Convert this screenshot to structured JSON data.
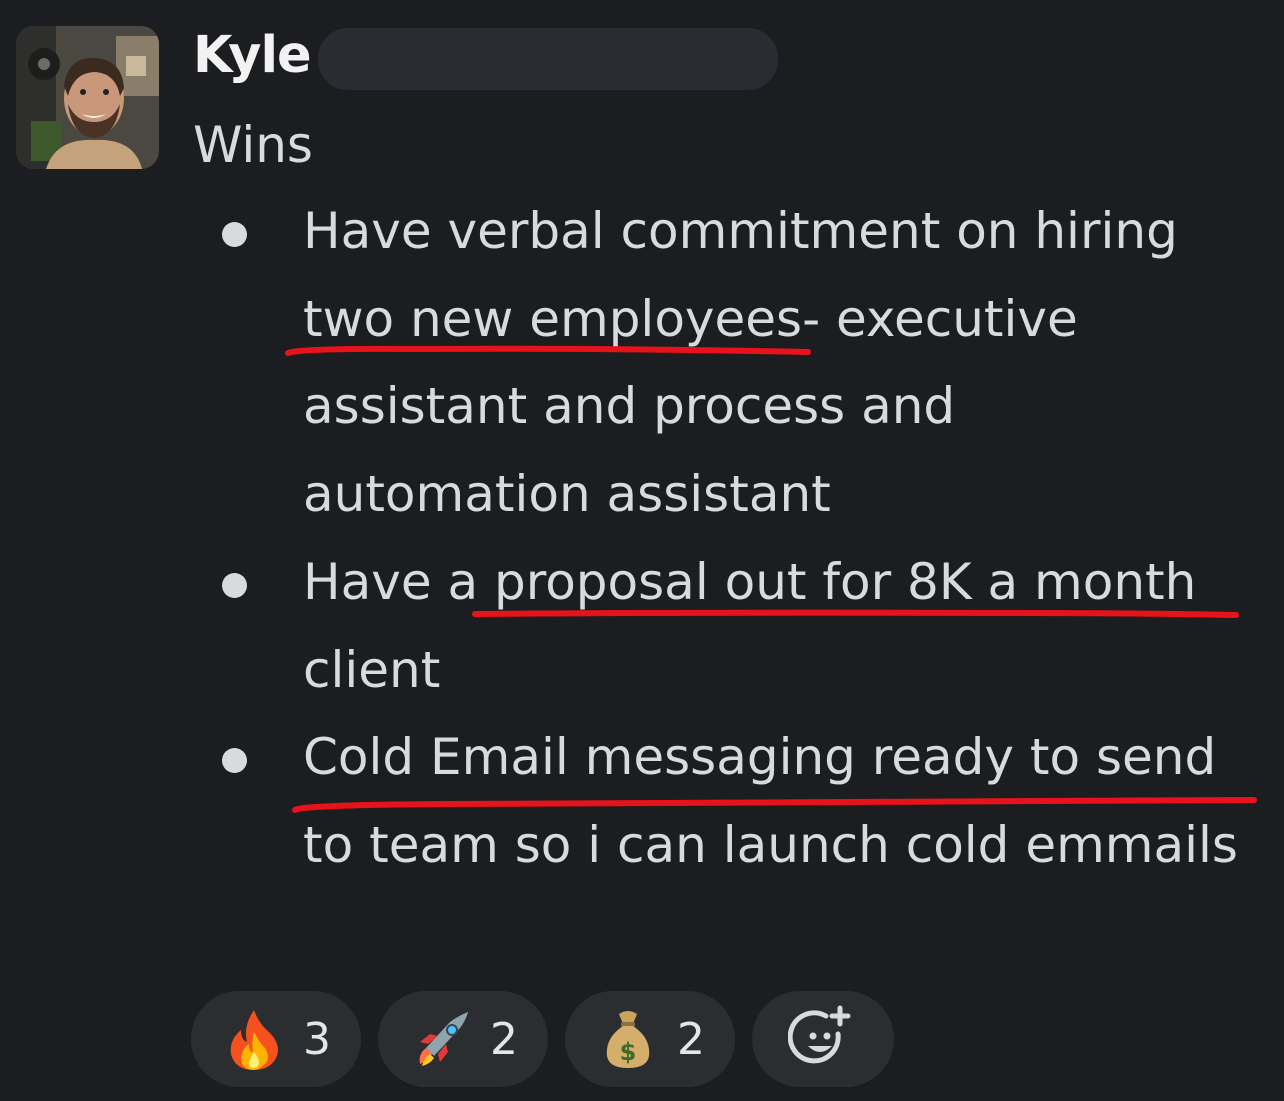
{
  "message": {
    "author": "Kyle",
    "section_title": "Wins",
    "bullets": [
      "Have verbal commitment on hiring two new employees- executive assistant and process and automation assistant",
      "Have a proposal out for 8K a month client",
      "Cold Email messaging ready to send to team so i can launch cold emmails"
    ]
  },
  "reactions": [
    {
      "icon": "fire-emoji",
      "count": "3"
    },
    {
      "icon": "rocket-emoji",
      "count": "2"
    },
    {
      "icon": "money-bag-emoji",
      "count": "2"
    }
  ],
  "colors": {
    "background": "#1b1d21",
    "text": "#d9dadc",
    "pill": "#2b2d31",
    "underline": "#e8131a"
  }
}
